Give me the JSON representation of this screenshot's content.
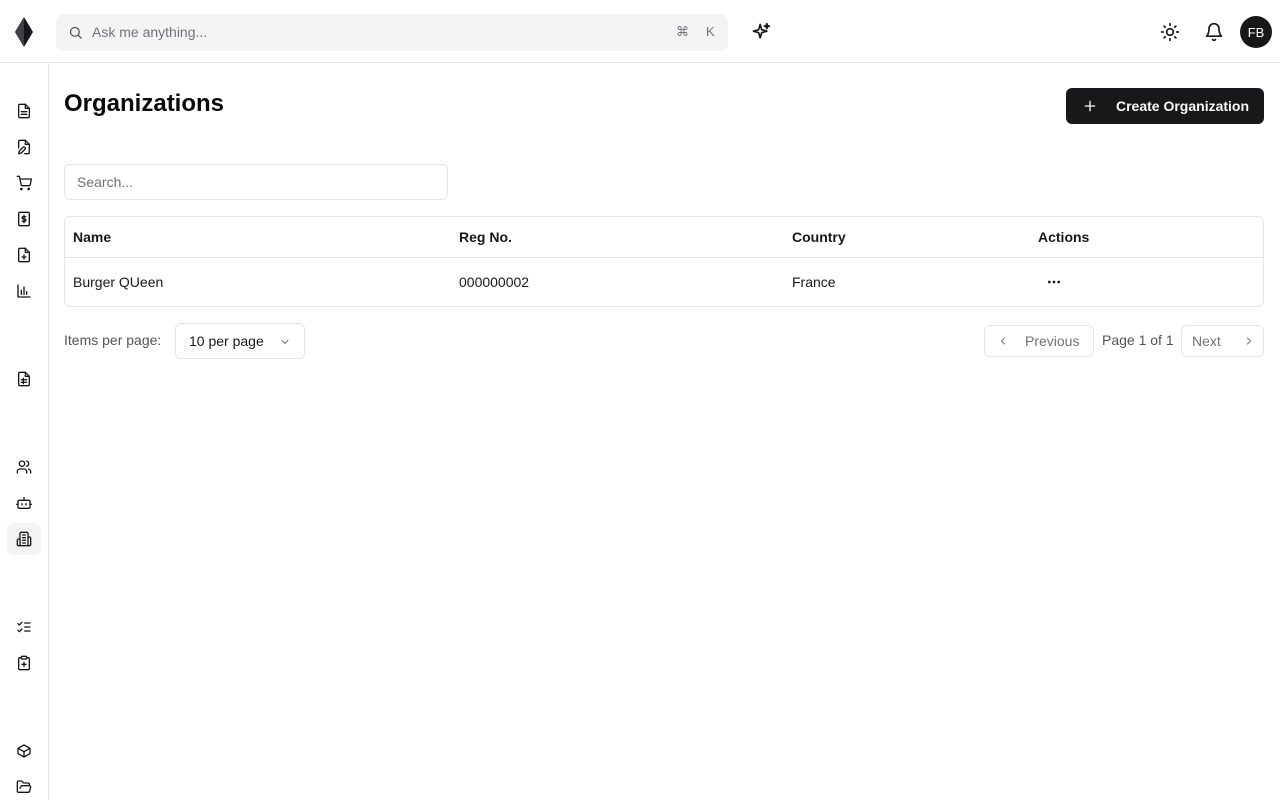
{
  "header": {
    "search_placeholder": "Ask me anything...",
    "shortcut_cmd": "⌘",
    "shortcut_key": "K",
    "avatar_initials": "FB"
  },
  "sidebar": {
    "items": [
      {
        "icon": "file-text-icon"
      },
      {
        "icon": "file-edit-icon"
      },
      {
        "icon": "shopping-cart-icon"
      },
      {
        "icon": "receipt-dollar-icon"
      },
      {
        "icon": "file-plus-icon"
      },
      {
        "icon": "bar-chart-icon"
      },
      {
        "icon": "file-spreadsheet-icon"
      },
      {
        "icon": "users-icon"
      },
      {
        "icon": "bot-icon"
      },
      {
        "icon": "building-icon",
        "active": true
      },
      {
        "icon": "list-checks-icon"
      },
      {
        "icon": "clipboard-plus-icon"
      },
      {
        "icon": "package-icon"
      },
      {
        "icon": "folder-open-icon"
      }
    ]
  },
  "main": {
    "title": "Organizations",
    "create_button_label": "Create Organization",
    "search_placeholder": "Search...",
    "table": {
      "columns": [
        "Name",
        "Reg No.",
        "Country",
        "Actions"
      ],
      "rows": [
        {
          "name": "Burger QUeen",
          "reg_no": "000000002",
          "country": "France"
        }
      ]
    },
    "pagination": {
      "items_per_page_label": "Items per page:",
      "items_per_page_value": "10 per page",
      "previous_label": "Previous",
      "page_info": "Page 1 of 1",
      "next_label": "Next"
    }
  },
  "colors": {
    "primary": "#18181b",
    "border": "#e4e4e7",
    "muted_text": "#71717a",
    "active_bg": "#f4f4f5"
  }
}
